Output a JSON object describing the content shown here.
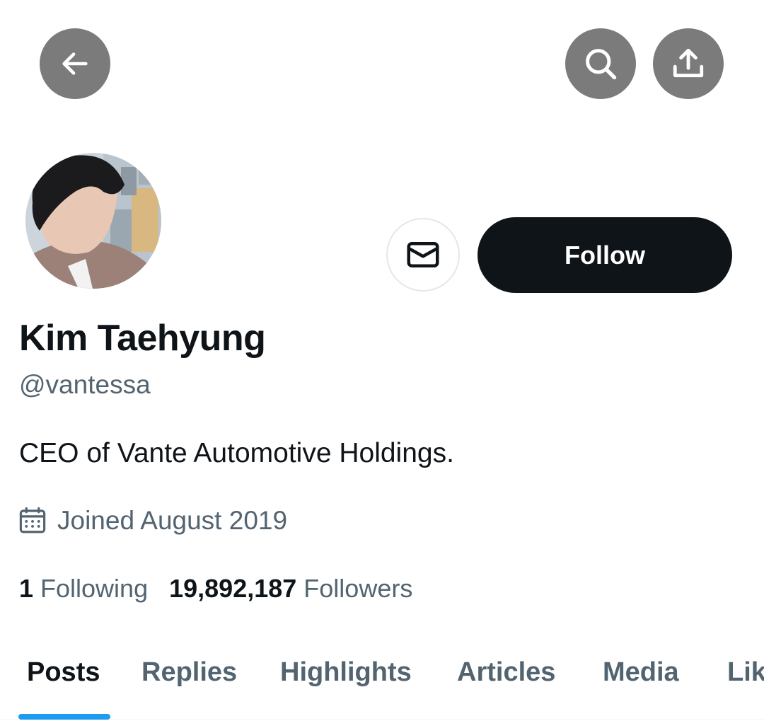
{
  "topbar": {
    "back_icon": "arrow-left-icon",
    "search_icon": "search-icon",
    "share_icon": "share-upload-icon",
    "button_color": "#7b7b7b"
  },
  "profile": {
    "display_name": "Kim Taehyung",
    "handle": "@vantessa",
    "bio": "CEO of Vante Automotive Holdings.",
    "joined": "Joined August 2019",
    "joined_icon": "calendar-icon",
    "message_icon": "envelope-icon",
    "follow_label": "Follow"
  },
  "stats": {
    "following_count": "1",
    "following_label": "Following",
    "followers_count": "19,892,187",
    "followers_label": "Followers"
  },
  "tabs": [
    {
      "label": "Posts",
      "active": true
    },
    {
      "label": "Replies",
      "active": false
    },
    {
      "label": "Highlights",
      "active": false
    },
    {
      "label": "Articles",
      "active": false
    },
    {
      "label": "Media",
      "active": false
    },
    {
      "label": "Lik",
      "active": false
    }
  ],
  "colors": {
    "text_primary": "#0f1419",
    "text_secondary": "#536471",
    "accent": "#1d9bf0",
    "follow_bg": "#0f1419"
  }
}
